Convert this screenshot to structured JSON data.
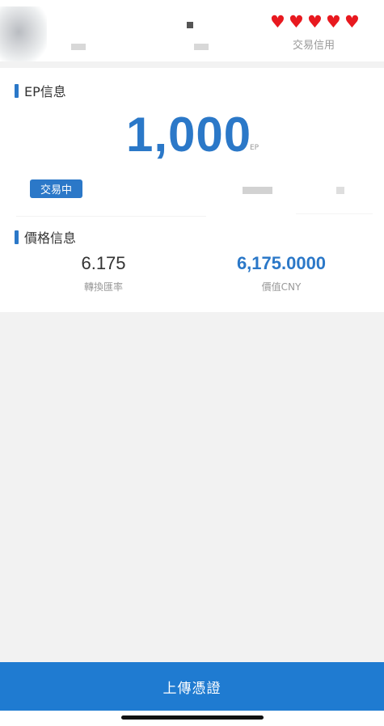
{
  "header": {
    "credit_hearts": 5,
    "heart_icon": "heart-icon",
    "heart_color": "#e8191f",
    "credit_label": "交易信用"
  },
  "ep_section": {
    "title": "EP信息",
    "amount": "1,000",
    "unit": "EP",
    "status_badge": "交易中"
  },
  "price_section": {
    "title": "價格信息",
    "exchange_rate": {
      "value": "6.175",
      "label": "轉換匯率"
    },
    "cny_value": {
      "value": "6,175.0000",
      "label": "價值CNY"
    }
  },
  "footer": {
    "upload_button_label": "上傳憑證"
  },
  "colors": {
    "accent": "#2b78c8",
    "button": "#1f7bd1",
    "background": "#f2f2f2"
  }
}
